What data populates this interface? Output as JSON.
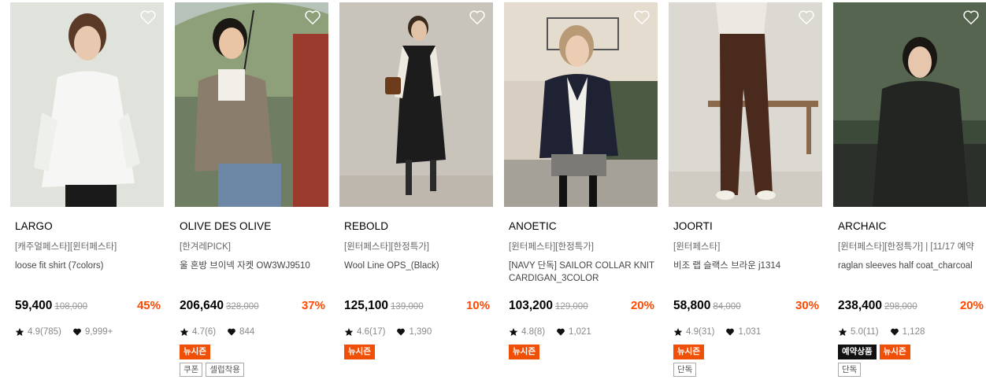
{
  "products": [
    {
      "brand": "LARGO",
      "tags": "[캐주얼페스타][윈터페스타]",
      "name": "loose fit shirt (7colors)",
      "price": "59,400",
      "original_price": "108,000",
      "discount": "45%",
      "rating": "4.9(785)",
      "likes": "9,999+",
      "badges": [],
      "outline_badges": [],
      "icon": "heart-outline-icon"
    },
    {
      "brand": "OLIVE DES OLIVE",
      "tags": "[한겨레PICK]",
      "name": "울 혼방 브이넥 자켓 OW3WJ9510",
      "price": "206,640",
      "original_price": "328,000",
      "discount": "37%",
      "rating": "4.7(6)",
      "likes": "844",
      "badges": [
        "뉴시즌"
      ],
      "outline_badges": [
        "쿠폰",
        "셀럽착용"
      ],
      "icon": "heart-outline-icon"
    },
    {
      "brand": "REBOLD",
      "tags": "[윈터페스타][한정특가]",
      "name": "Wool Line OPS_(Black)",
      "price": "125,100",
      "original_price": "139,000",
      "discount": "10%",
      "rating": "4.6(17)",
      "likes": "1,390",
      "badges": [
        "뉴시즌"
      ],
      "outline_badges": [],
      "icon": "heart-outline-icon"
    },
    {
      "brand": "ANOETIC",
      "tags": "[윈터페스타][한정특가]",
      "name": "[NAVY 단독] SAILOR COLLAR KNIT CARDIGAN_3COLOR",
      "price": "103,200",
      "original_price": "129,000",
      "discount": "20%",
      "rating": "4.8(8)",
      "likes": "1,021",
      "badges": [
        "뉴시즌"
      ],
      "outline_badges": [],
      "icon": "heart-outline-icon"
    },
    {
      "brand": "JOORTI",
      "tags": "[윈터페스타]",
      "name": "비조 랩 슬랙스 브라운 j1314",
      "price": "58,800",
      "original_price": "84,000",
      "discount": "30%",
      "rating": "4.9(31)",
      "likes": "1,031",
      "badges": [
        "뉴시즌"
      ],
      "outline_badges": [
        "단독"
      ],
      "icon": "heart-outline-icon"
    },
    {
      "brand": "ARCHAIC",
      "tags": "[윈터페스타][한정특가] | [11/17 예약",
      "name": "raglan sleeves half coat_charcoal",
      "price": "238,400",
      "original_price": "298,000",
      "discount": "20%",
      "rating": "5.0(11)",
      "likes": "1,128",
      "badges": [
        "예약상품",
        "뉴시즌"
      ],
      "outline_badges": [
        "단독"
      ],
      "icon": "heart-outline-icon"
    }
  ],
  "colors": {
    "discount": "#ff4800",
    "new_season_badge": "#f04f07",
    "preorder_badge": "#111111"
  }
}
